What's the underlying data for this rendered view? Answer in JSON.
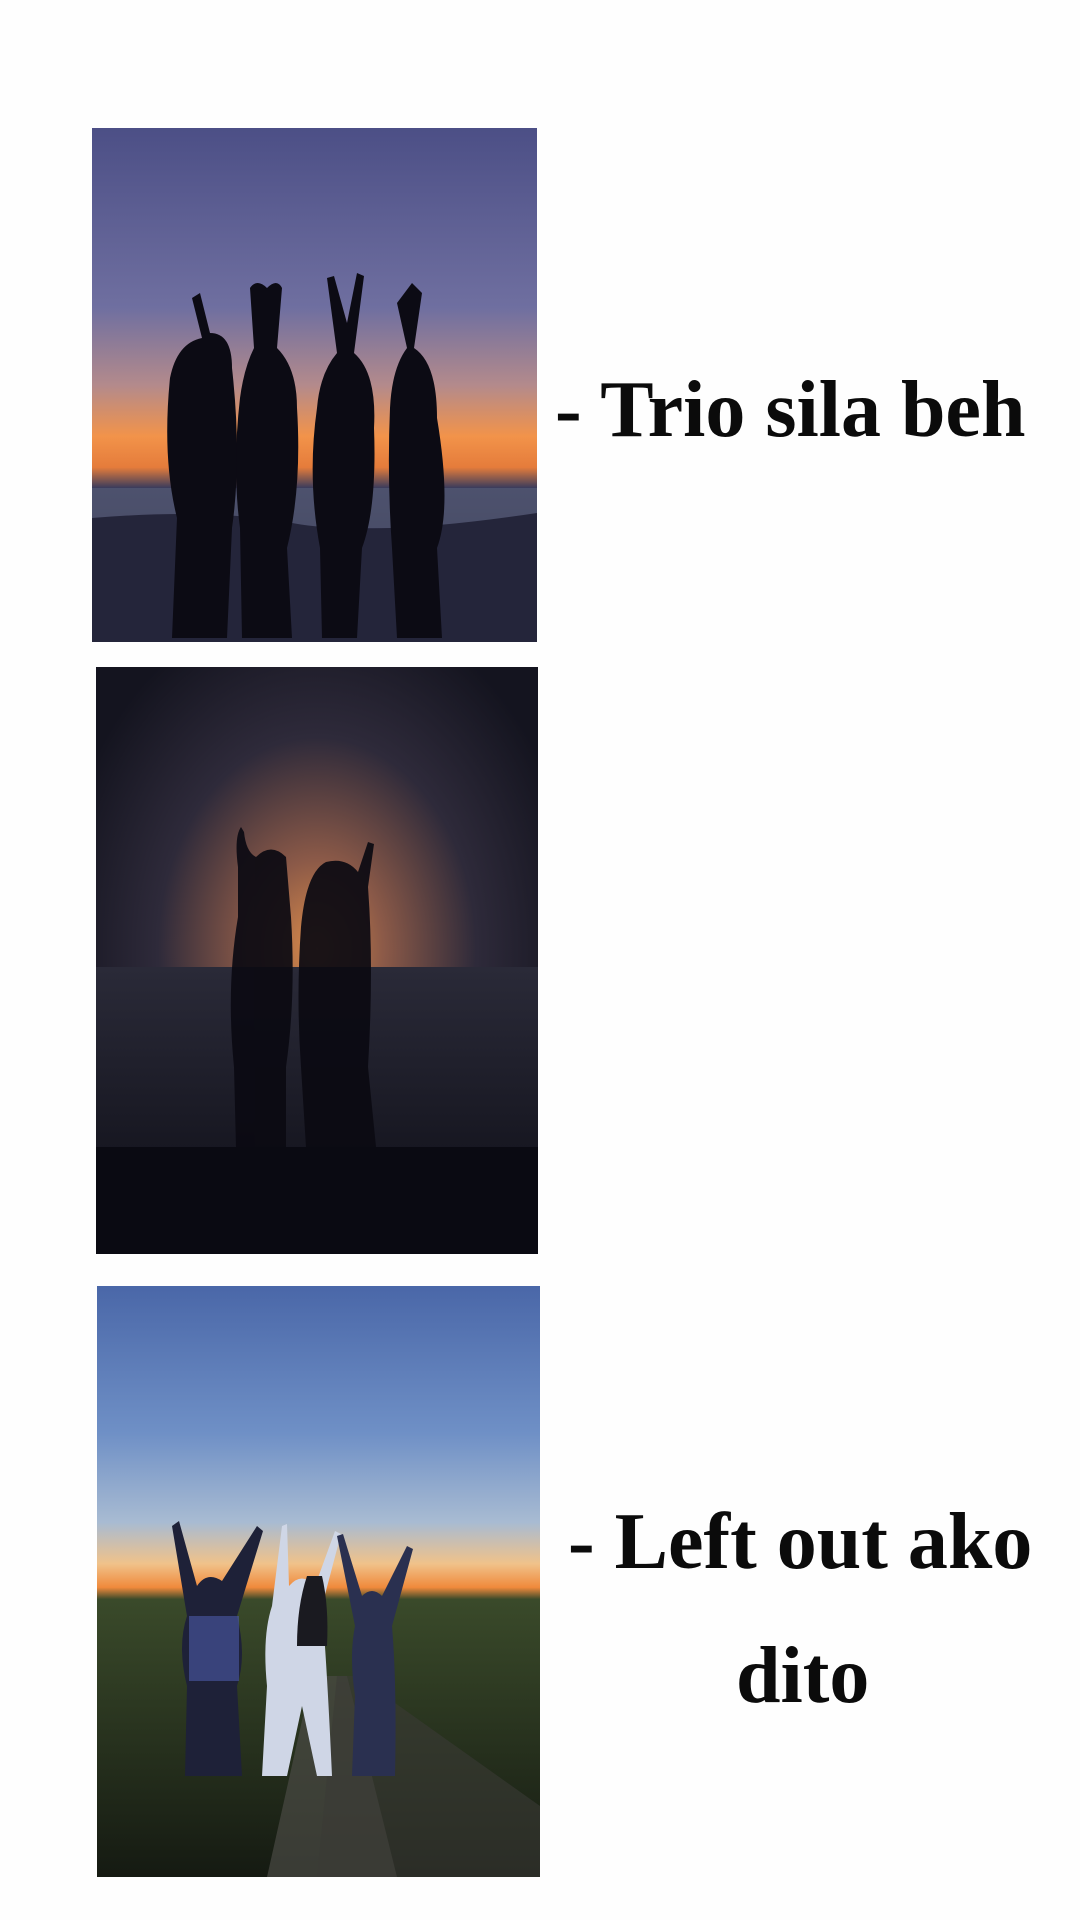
{
  "panels": [
    {
      "caption": "- Trio sila beh"
    },
    {
      "caption": ""
    },
    {
      "caption_line1": "- Left out ako",
      "caption_line2": "dito"
    }
  ],
  "colors": {
    "background": "#fefefe",
    "text": "#0b0b0b",
    "sunset_orange": "#f08a3c",
    "dusk_blue": "#4a63a8"
  }
}
